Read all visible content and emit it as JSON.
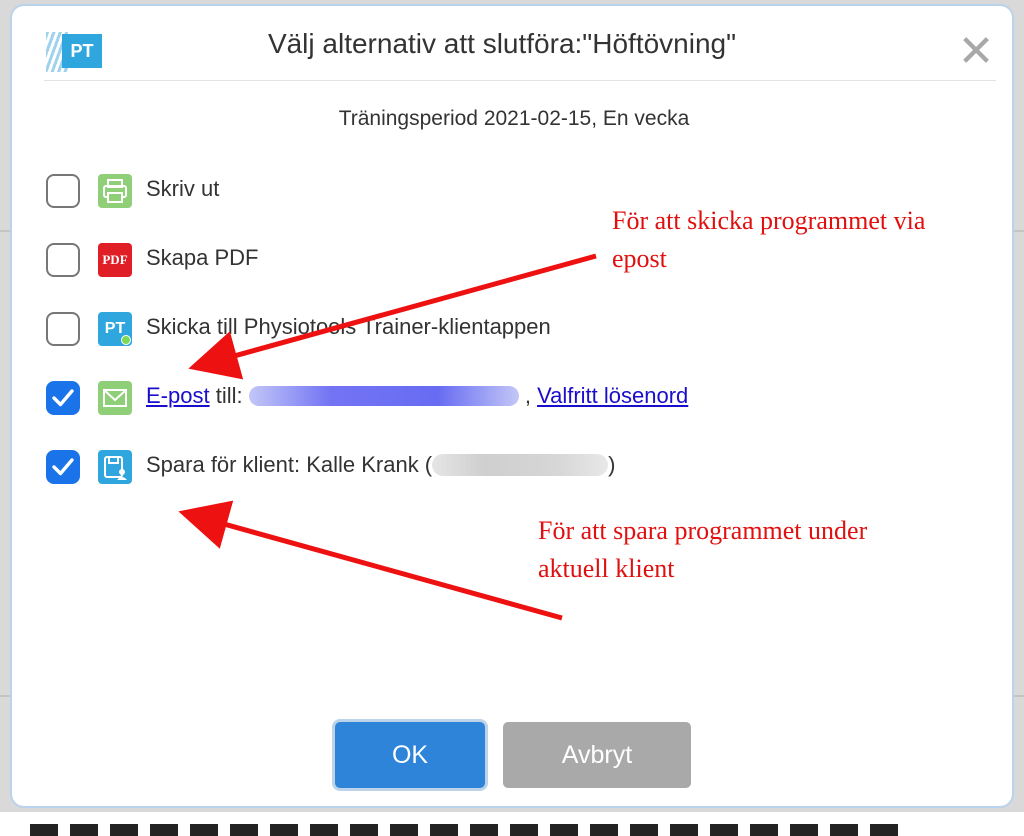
{
  "dialog": {
    "title": "Välj alternativ att slutföra:\"Höftövning\"",
    "subtitle": "Träningsperiod 2021-02-15, En vecka",
    "logo_text": "PT",
    "close_glyph": "✕"
  },
  "options": {
    "print": {
      "label": "Skriv ut",
      "checked": false,
      "icon": "printer-icon"
    },
    "pdf": {
      "label": "Skapa PDF",
      "checked": false,
      "icon": "pdf-icon",
      "icon_text": "PDF"
    },
    "app": {
      "label": "Skicka till Physiotools Trainer-klientappen",
      "checked": false,
      "icon": "pt-app-icon",
      "icon_text": "PT"
    },
    "email": {
      "link_label": "E-post",
      "text_till": " till: ",
      "separator": " , ",
      "password_link": "Valfritt lösenord",
      "checked": true,
      "icon": "envelope-icon"
    },
    "save": {
      "label": "Spara för klient: Kalle Krank (",
      "label_end": ")",
      "checked": true,
      "icon": "save-client-icon"
    }
  },
  "annotations": {
    "email_note": [
      "För att skicka programmet via",
      "epost"
    ],
    "save_note": [
      "För att spara programmet under",
      "aktuell klient"
    ]
  },
  "buttons": {
    "ok": "OK",
    "cancel": "Avbryt"
  },
  "colors": {
    "primary": "#2e84d8",
    "checkbox": "#1a73e8",
    "annotation": "#e01010",
    "cancel": "#a9a9a9"
  }
}
